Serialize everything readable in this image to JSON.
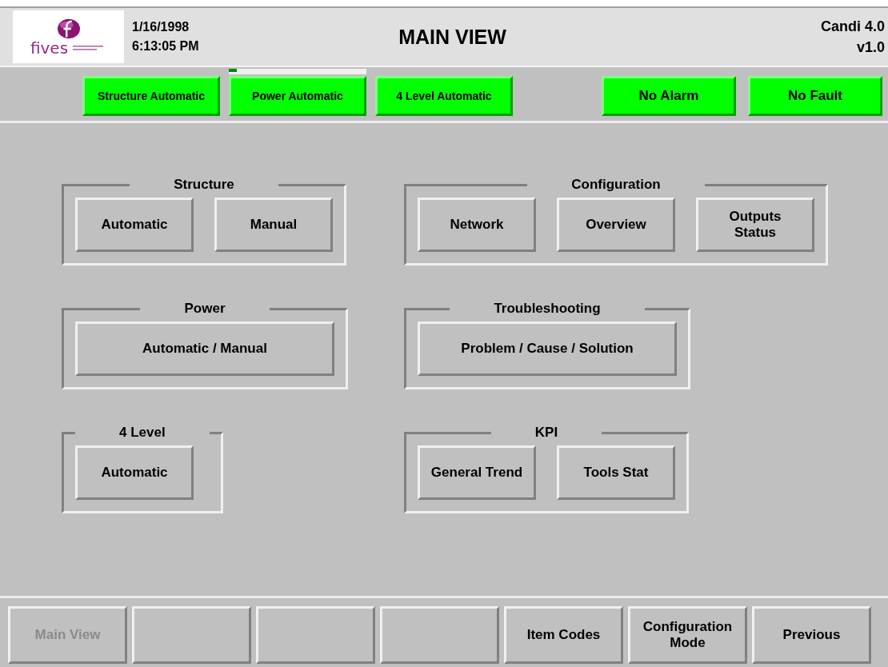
{
  "header": {
    "logo_text": "fives",
    "date": "1/16/1998",
    "time": "6:13:05 PM",
    "title": "MAIN VIEW",
    "product": "Candi 4.0",
    "version": "v1.0"
  },
  "status_left": [
    {
      "label": "Structure Automatic"
    },
    {
      "label": "Power Automatic",
      "progress": {
        "level": 0.06
      }
    },
    {
      "label": "4 Level Automatic"
    }
  ],
  "status_right": [
    {
      "label": "No Alarm"
    },
    {
      "label": "No Fault"
    }
  ],
  "groups": [
    {
      "title": "Structure",
      "buttons": [
        {
          "label": "Automatic",
          "kind": "standard"
        },
        {
          "label": "Manual",
          "kind": "standard"
        }
      ]
    },
    {
      "title": "Configuration",
      "buttons": [
        {
          "label": "Network",
          "kind": "standard"
        },
        {
          "label": "Overview",
          "kind": "standard"
        },
        {
          "label": "Outputs\nStatus",
          "kind": "standard"
        }
      ]
    },
    {
      "title": "Power",
      "buttons": [
        {
          "label": "Automatic / Manual",
          "kind": "wide"
        }
      ]
    },
    {
      "title": "Troubleshooting",
      "buttons": [
        {
          "label": "Problem / Cause / Solution",
          "kind": "wide"
        }
      ]
    },
    {
      "title": "4 Level",
      "buttons": [
        {
          "label": "Automatic",
          "kind": "standard"
        }
      ]
    },
    {
      "title": "KPI",
      "buttons": [
        {
          "label": "General Trend",
          "kind": "standard"
        },
        {
          "label": "Tools Stat",
          "kind": "standard"
        }
      ]
    }
  ],
  "nav_buttons": [
    {
      "kind": "labeled",
      "label": "Main View",
      "disabled": true
    },
    {
      "kind": "blank"
    },
    {
      "kind": "blank"
    },
    {
      "kind": "blank"
    },
    {
      "kind": "labeled",
      "label": "Item Codes",
      "disabled": false
    },
    {
      "kind": "labeled",
      "label": "Configuration\nMode",
      "disabled": false
    },
    {
      "kind": "labeled",
      "label": "Previous",
      "disabled": false
    }
  ]
}
